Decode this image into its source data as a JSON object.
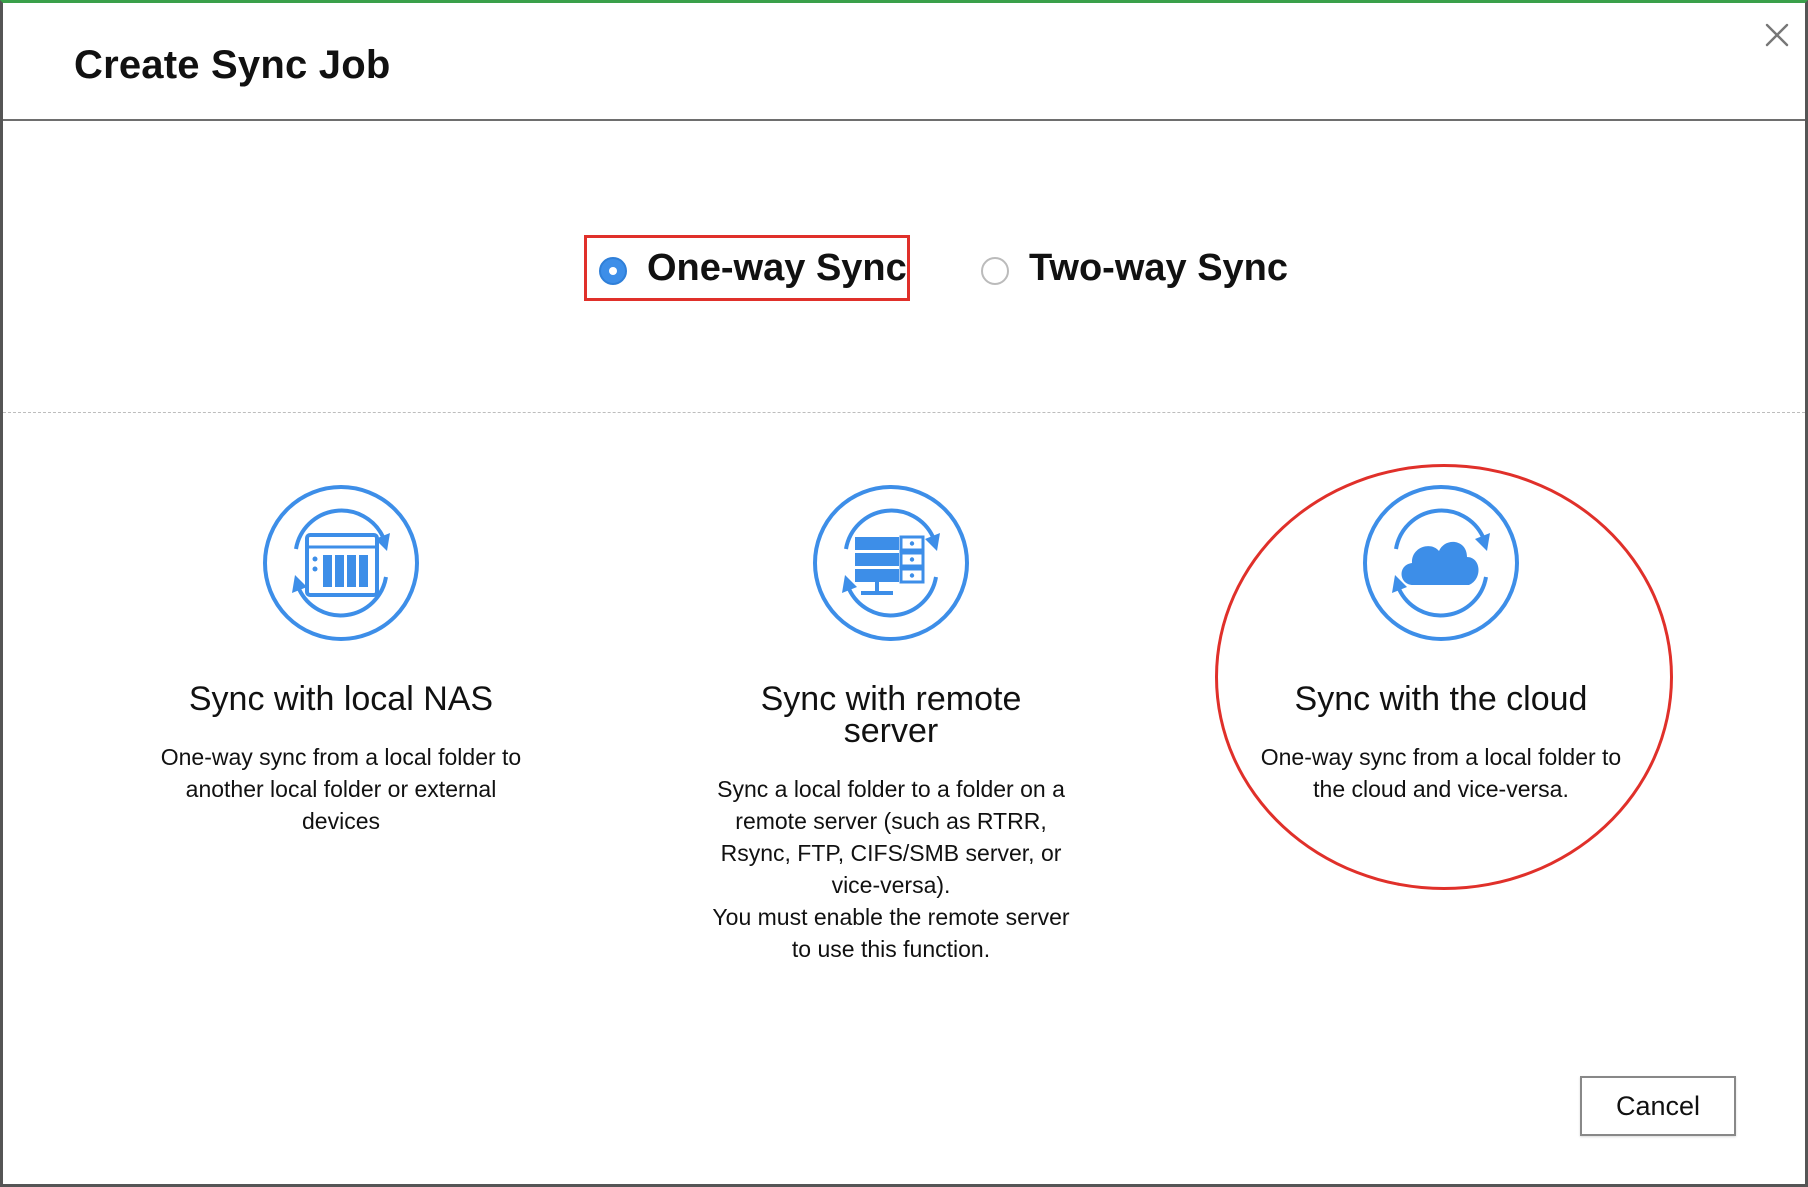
{
  "dialog": {
    "title": "Create Sync Job",
    "close_icon": "close-icon"
  },
  "sync_mode": {
    "options": [
      {
        "label": "One-way Sync",
        "selected": true
      },
      {
        "label": "Two-way Sync",
        "selected": false
      }
    ]
  },
  "targets": [
    {
      "icon": "nas-sync-icon",
      "title": "Sync with local NAS",
      "description": [
        "One-way sync from a local folder to",
        "another local folder or external",
        "devices"
      ]
    },
    {
      "icon": "server-sync-icon",
      "title_lines": [
        "Sync with remote",
        "server"
      ],
      "description": [
        "Sync a local folder to a folder on a",
        "remote server (such as RTRR,",
        "Rsync, FTP, CIFS/SMB server, or",
        "vice-versa).",
        "You must enable the remote server",
        "to use this function."
      ]
    },
    {
      "icon": "cloud-sync-icon",
      "title": "Sync with the cloud",
      "description": [
        "One-way sync from a local folder to",
        "the cloud and vice-versa."
      ]
    }
  ],
  "footer": {
    "cancel_label": "Cancel"
  },
  "colors": {
    "accent_blue": "#3d8ee8",
    "highlight_red": "#e0302a",
    "header_top_border": "#3aa04a"
  }
}
